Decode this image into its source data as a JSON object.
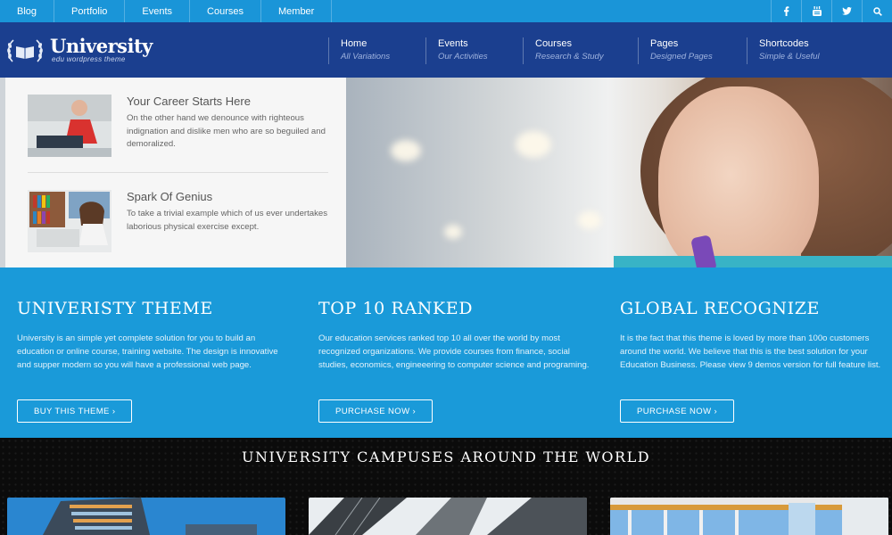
{
  "topbar": {
    "links": [
      "Blog",
      "Portfolio",
      "Events",
      "Courses",
      "Member"
    ],
    "social_icons": [
      "facebook-icon",
      "youtube-icon",
      "twitter-icon",
      "search-icon"
    ]
  },
  "header": {
    "logo_title": "University",
    "logo_subtitle": "edu wordpress theme",
    "nav": [
      {
        "title": "Home",
        "subtitle": "All Variations"
      },
      {
        "title": "Events",
        "subtitle": "Our Activities"
      },
      {
        "title": "Courses",
        "subtitle": "Research & Study"
      },
      {
        "title": "Pages",
        "subtitle": "Designed Pages"
      },
      {
        "title": "Shortcodes",
        "subtitle": "Simple & Useful"
      }
    ]
  },
  "hero": {
    "cards": [
      {
        "title": "Your Career Starts Here",
        "text": "On the other hand we denounce with righteous indignation and dislike men who are so beguiled and demoralized."
      },
      {
        "title": "Spark Of Genius",
        "text": "To take a trivial example which of us ever undertakes laborious physical exercise except."
      }
    ]
  },
  "features": [
    {
      "title": "UNIVERISTY THEME",
      "text": "University is an simple yet complete solution for you to build an education or online course, training website. The design is innovative and supper modern so you will have a professional web page.",
      "button": "BUY THIS THEME  ›"
    },
    {
      "title": "TOP 10 RANKED",
      "text": "Our education services ranked top 10 all over the world by most recognized organizations. We provide courses from finance, social studies, economics, engineeering to computer science and programing.",
      "button": "PURCHASE NOW  ›"
    },
    {
      "title": "GLOBAL RECOGNIZE",
      "text": "It is the fact that this theme is loved by more than 100o customers around the world. We believe that this is the best solution for your Education Business. Please view 9 demos version for full feature list.",
      "button": "PURCHASE NOW  ›"
    }
  ],
  "campuses": {
    "title": "UNIVERSITY CAMPUSES AROUND THE WORLD"
  },
  "colors": {
    "topbar": "#1a95d8",
    "header": "#1b3f8f",
    "features": "#1a9ad9",
    "campuses": "#0b0b0b"
  }
}
